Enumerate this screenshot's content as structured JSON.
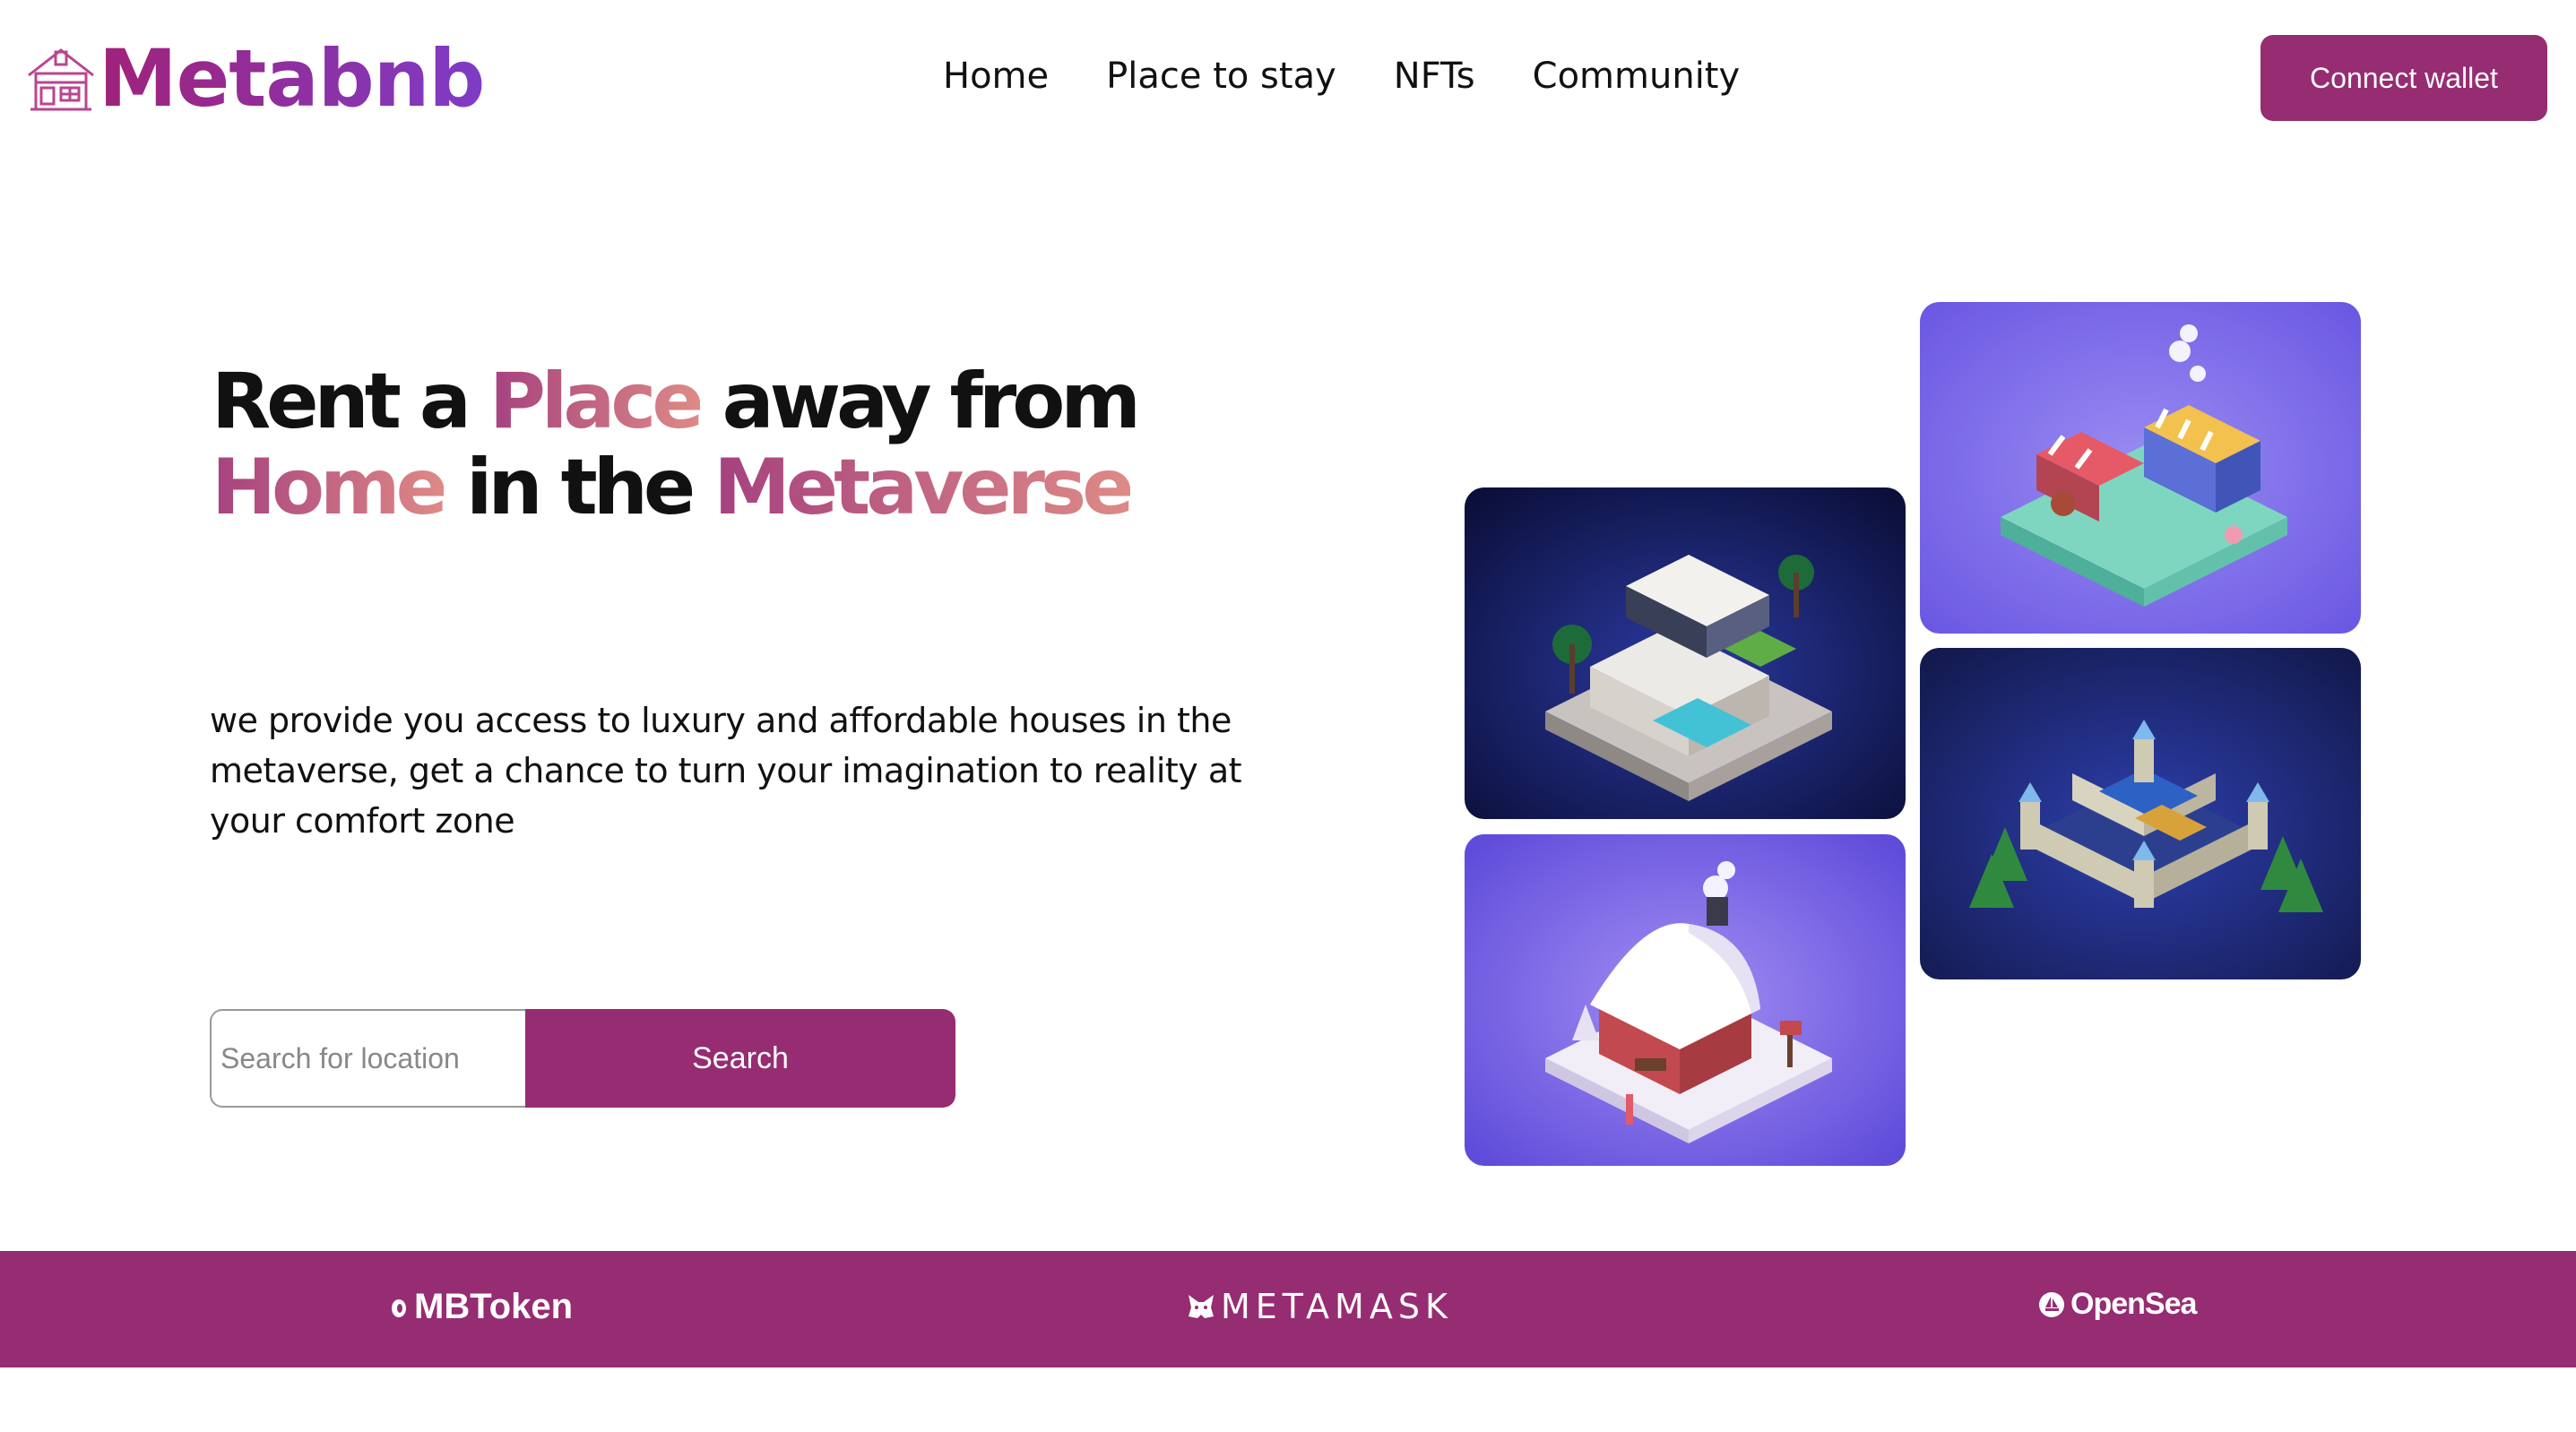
{
  "brand": {
    "name": "Metabnb",
    "logo_icon": "house-icon"
  },
  "nav": {
    "items": [
      {
        "label": "Home"
      },
      {
        "label": "Place to stay"
      },
      {
        "label": "NFTs"
      },
      {
        "label": "Community"
      }
    ],
    "connect_label": "Connect wallet"
  },
  "hero": {
    "headline": {
      "w1": "Rent a ",
      "w2": "Place",
      "w3": " away from",
      "w4": "Home",
      "w5": " in the ",
      "w6": "Metaverse"
    },
    "subtext": "we provide you access to luxury and affordable houses in the metaverse, get a chance to turn your imagination to reality at your comfort zone",
    "search": {
      "placeholder": "Search for location",
      "value": "",
      "button_label": "Search"
    }
  },
  "partners": [
    {
      "name": "MBToken",
      "icon": "mbtoken-icon"
    },
    {
      "name": "METAMASK",
      "icon": "fox-icon"
    },
    {
      "name": "OpenSea",
      "icon": "opensea-icon"
    }
  ],
  "colors": {
    "brand_primary": "#962c72",
    "gradient_start": "#a5417f",
    "gradient_end": "#de8a86",
    "logo_gradient_end": "#7e3cc6"
  }
}
